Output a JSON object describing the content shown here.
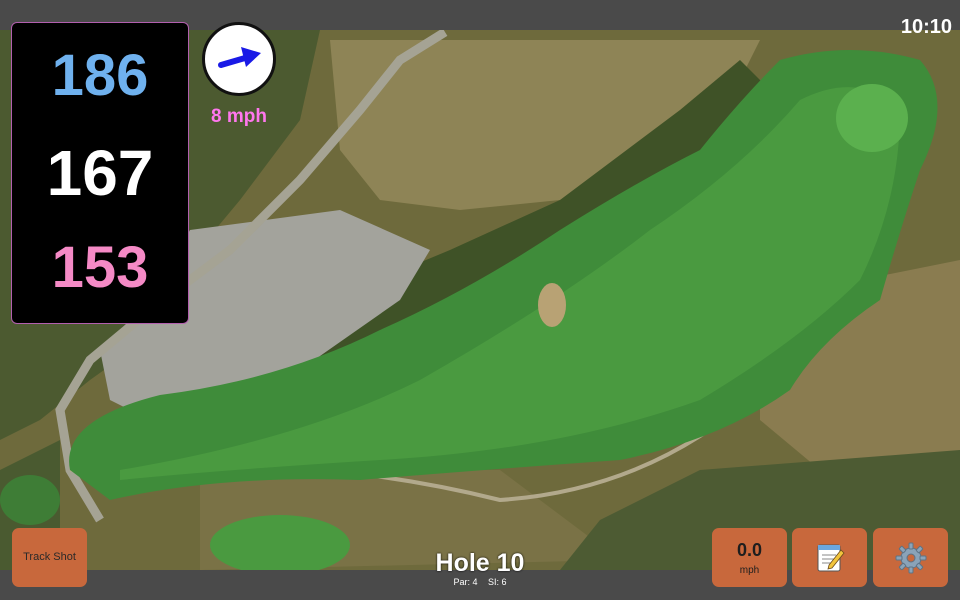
{
  "status_bar": {
    "time": "10:10"
  },
  "distances": {
    "back": "186",
    "center": "167",
    "front": "153",
    "colors": {
      "back": "#6fb1ee",
      "center": "#ffffff",
      "front": "#f58ac6"
    }
  },
  "wind": {
    "speed_label": "8 mph",
    "label_color": "#ff77ee",
    "arrow_color": "#1a1ae6",
    "icon": "wind-direction-arrow-icon"
  },
  "hole": {
    "title": "Hole 10",
    "par_label": "Par: 4",
    "si_label": "SI: 6"
  },
  "buttons": {
    "track_shot": "Track Shot",
    "speed_value": "0.0",
    "speed_unit": "mph",
    "notes_icon": "notepad-icon",
    "settings_icon": "gear-icon",
    "accent": "#c8683c"
  }
}
